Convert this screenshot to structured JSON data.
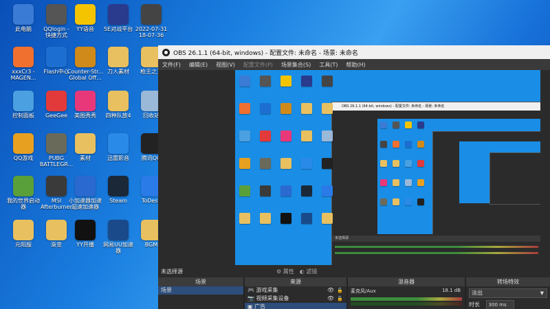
{
  "desktop": {
    "icons": [
      {
        "label": "此电脑",
        "icon": "computer-icon",
        "color": "#3a7bd5"
      },
      {
        "label": "QQlogin -\n快捷方式",
        "icon": "qq-login-icon",
        "color": "#555555"
      },
      {
        "label": "YY语音",
        "icon": "yy-icon",
        "color": "#f5c400"
      },
      {
        "label": "5E对战平台",
        "icon": "5e-icon",
        "color": "#2a3a8c"
      },
      {
        "label": "2022-07-31\n18-07-36",
        "icon": "video-file-icon",
        "color": "#444444"
      },
      {
        "label": "xxxCr3 -\nMAGEN...",
        "icon": "flac-file-icon",
        "color": "#f07030"
      },
      {
        "label": "Flash中心",
        "icon": "flash-icon",
        "color": "#1c6fd0"
      },
      {
        "label": "Counter-Str...\nGlobal Off...",
        "icon": "csgo-icon",
        "color": "#d08a1a"
      },
      {
        "label": "刀人素材",
        "icon": "folder-icon",
        "color": "#e8c060"
      },
      {
        "label": "枪王之王",
        "icon": "folder-icon",
        "color": "#e8c060"
      },
      {
        "label": "控制面板",
        "icon": "control-panel-icon",
        "color": "#4aa0e0"
      },
      {
        "label": "GeeGee",
        "icon": "geegee-icon",
        "color": "#e23a3a"
      },
      {
        "label": "美图秀秀",
        "icon": "meitu-icon",
        "color": "#e8387a"
      },
      {
        "label": "四种队放4",
        "icon": "folder-icon",
        "color": "#e8c060"
      },
      {
        "label": "回收站",
        "icon": "recycle-bin-icon",
        "color": "#9ab8d8"
      },
      {
        "label": "QQ游戏",
        "icon": "qq-game-icon",
        "color": "#e8a020"
      },
      {
        "label": "PUBG\nBATTLEGR...",
        "icon": "pubg-icon",
        "color": "#6a6a5a"
      },
      {
        "label": "素材",
        "icon": "folder-icon",
        "color": "#e8c060"
      },
      {
        "label": "迅雷影音",
        "icon": "xunlei-icon",
        "color": "#2a8ae8"
      },
      {
        "label": "腾讯QQ",
        "icon": "qq-icon",
        "color": "#222222"
      },
      {
        "label": "我的世界启动\n器",
        "icon": "minecraft-icon",
        "color": "#5aa03a"
      },
      {
        "label": "MSI\nAfterburner",
        "icon": "msi-icon",
        "color": "#3a3a3a"
      },
      {
        "label": "小加速器加速\n超速加速器",
        "icon": "accelerator-icon",
        "color": "#2a6ad0"
      },
      {
        "label": "Steam",
        "icon": "steam-icon",
        "color": "#1b2838"
      },
      {
        "label": "ToDesk",
        "icon": "todesk-icon",
        "color": "#2a7ae8"
      },
      {
        "label": "元阳服",
        "icon": "folder-icon",
        "color": "#e8c060"
      },
      {
        "label": "渐变",
        "icon": "folder-icon",
        "color": "#e8c060"
      },
      {
        "label": "YY开播",
        "icon": "yy-live-icon",
        "color": "#111111"
      },
      {
        "label": "网易UU加速\n器",
        "icon": "uu-icon",
        "color": "#1a4a8a"
      },
      {
        "label": "BGM",
        "icon": "folder-icon",
        "color": "#e8c060"
      }
    ]
  },
  "obs": {
    "title": "OBS 26.1.1 (64-bit, windows) - 配置文件: 未命名 - 场景: 未命名",
    "menu": [
      "文件(F)",
      "编辑(E)",
      "视图(V)",
      "配置文件(P)",
      "场景集合(S)",
      "工具(T)",
      "帮助(H)"
    ],
    "nested_title": "OBS 26.1.1 (64-bit, windows) - 配置文件: 未命名 - 场景: 未命名",
    "no_source": "未选择源",
    "properties_btn": "属性",
    "filters_btn": "滤镜",
    "scenes": {
      "header": "场景",
      "items": [
        "场景"
      ]
    },
    "sources": {
      "header": "来源",
      "items": [
        "游戏采集",
        "视频采集设备",
        "广告"
      ]
    },
    "mixer": {
      "header": "混音器",
      "channel": "麦克风/Aux",
      "db": "18.1 dB"
    },
    "transitions": {
      "header": "转场特效",
      "selected": "淡出",
      "duration_label": "时长",
      "duration_value": "300 ms"
    }
  }
}
